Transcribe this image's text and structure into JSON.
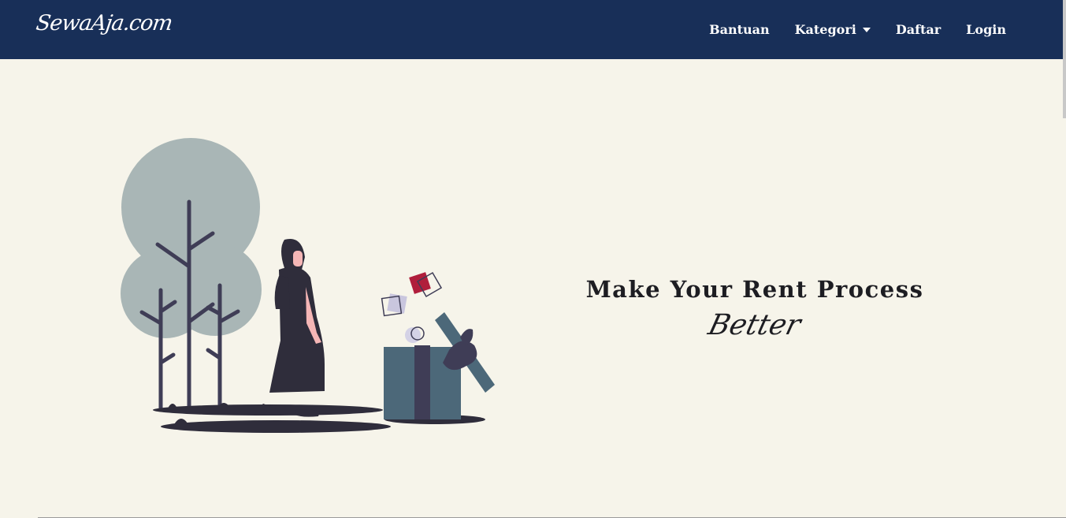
{
  "colors": {
    "navbar": "#182f58",
    "background": "#f6f4ea",
    "text_dark": "#1d1d22",
    "tree": "#a9b6b6",
    "figure": "#2f2d3b",
    "box": "#4c6879",
    "accent_red": "#b01e3c"
  },
  "navbar": {
    "brand": "SewaAja.com",
    "links": {
      "help": "Bantuan",
      "category": "Kategori",
      "register": "Daftar",
      "login": "Login"
    }
  },
  "hero": {
    "title": "Make Your Rent Process",
    "accent": "Better",
    "illustration_icon": "woman-gift-box-illustration"
  }
}
